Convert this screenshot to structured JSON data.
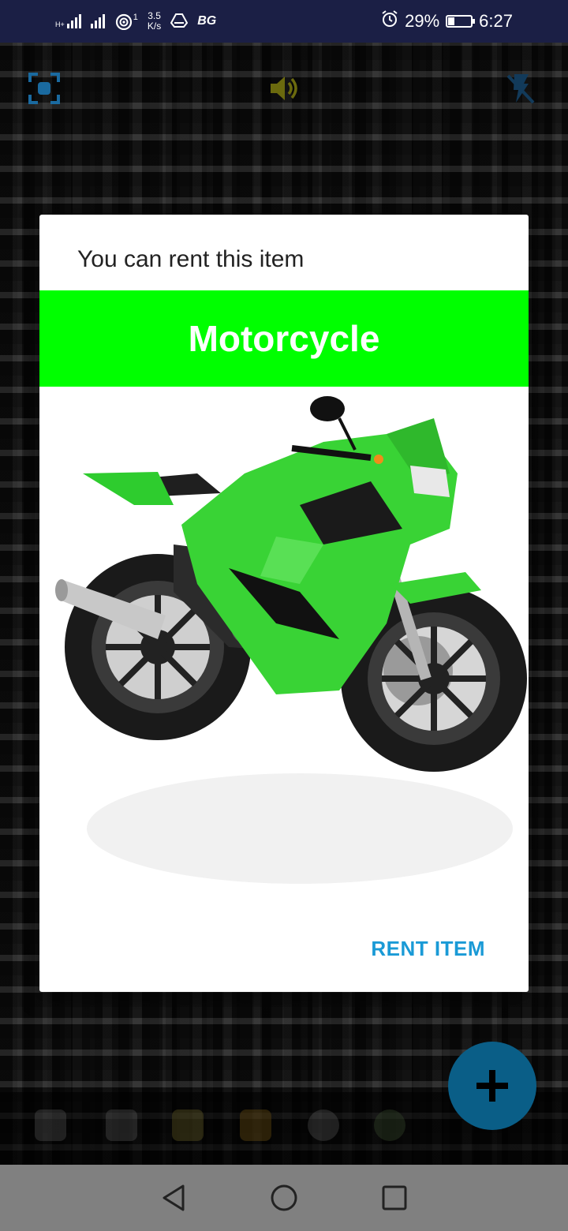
{
  "status_bar": {
    "network_type": "H+",
    "sim_slot": "1",
    "speed_value": "3.5",
    "speed_unit": "K/s",
    "carrier_tag": "BG",
    "battery_percent": "29%",
    "battery_level": 0.29,
    "time": "6:27"
  },
  "scanner_toolbar": {
    "icons": [
      "focus-frame-icon",
      "speaker-icon",
      "flash-off-icon"
    ]
  },
  "dialog": {
    "title": "You can rent this item",
    "item_name": "Motorcycle",
    "banner_color": "#00ff00",
    "image_subject": "green sport motorcycle",
    "rent_button_label": "RENT ITEM",
    "accent_color": "#1a9ad6"
  },
  "fab": {
    "icon": "plus-icon",
    "color": "#0a5e87"
  },
  "nav_bar": {
    "items": [
      "back-icon",
      "home-icon",
      "recents-icon"
    ]
  }
}
